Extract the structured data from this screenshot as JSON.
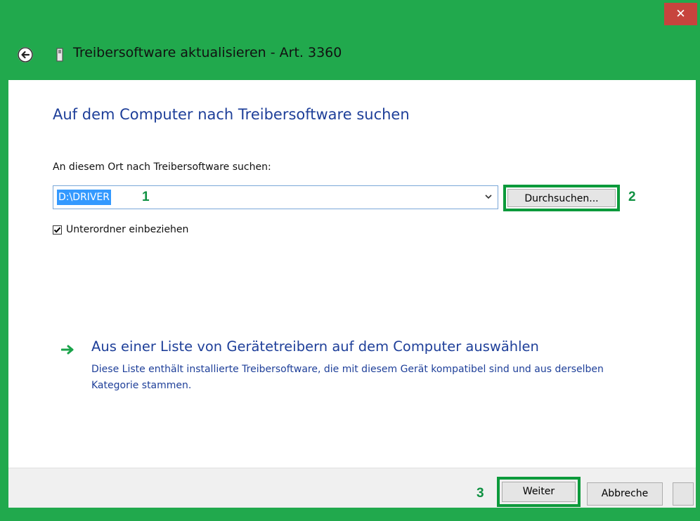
{
  "window": {
    "title": "Treibersoftware aktualisieren - Art. 3360",
    "close_symbol": "✕",
    "back_icon": "back-arrow-icon",
    "device_icon": "usb-device-icon"
  },
  "main": {
    "heading": "Auf dem Computer nach Treibersoftware suchen",
    "search_label": "An diesem Ort nach Treibersoftware suchen:",
    "path_value": "D:\\DRIVER",
    "browse_label": "Durchsuchen...",
    "include_subfolders_label": "Unterordner einbeziehen",
    "include_subfolders_checked": true,
    "list_option": {
      "title": "Aus einer Liste von Gerätetreibern auf dem Computer auswählen",
      "description": "Diese Liste enthält installierte Treibersoftware, die mit diesem Gerät kompatibel sind und aus derselben Kategorie stammen."
    }
  },
  "annotations": {
    "marker_1": "1",
    "marker_2": "2",
    "marker_3": "3",
    "color": "#0f9142"
  },
  "footer": {
    "next_label": "Weiter",
    "cancel_label": "Abbreche"
  },
  "colors": {
    "frame": "#21a94d",
    "close_button": "#c7443d",
    "link_blue": "#1e3f99",
    "selection": "#3399ff"
  }
}
